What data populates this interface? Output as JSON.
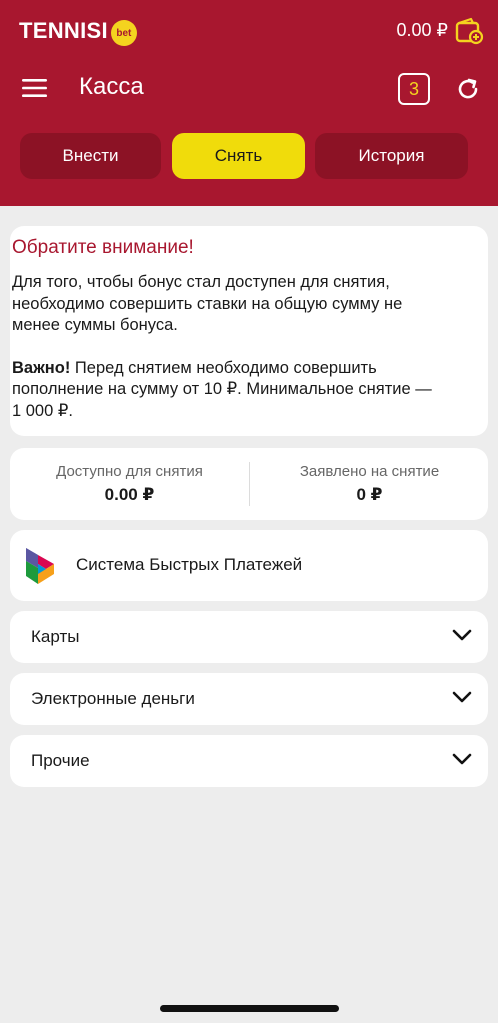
{
  "header": {
    "brand": "TENNISI",
    "brand_badge": "bet",
    "balance": "0.00 ₽",
    "title": "Касса",
    "ticket_count": "3"
  },
  "tabs": [
    {
      "label": "Внести",
      "active": false
    },
    {
      "label": "Снять",
      "active": true
    },
    {
      "label": "История",
      "active": false
    }
  ],
  "notice": {
    "title": "Обратите внимание!",
    "line1": "Для того, чтобы бонус стал доступен для снятия,",
    "line2": "необходимо совершить ставки на общую сумму не",
    "line3": "менее суммы бонуса.",
    "important_label": "Важно!",
    "important_line1": " Перед снятием необходимо совершить",
    "important_line2": "пополнение на сумму от 10 ₽. Минимальное снятие —",
    "important_line3": "1 000 ₽."
  },
  "stats": {
    "available_label": "Доступно для снятия",
    "available_value": "0.00 ₽",
    "requested_label": "Заявлено на снятие",
    "requested_value": "0 ₽"
  },
  "payment_methods": {
    "sbp_label": "Система Быстрых Платежей",
    "sections": [
      {
        "label": "Карты"
      },
      {
        "label": "Электронные деньги"
      },
      {
        "label": "Прочие"
      }
    ]
  },
  "colors": {
    "brand": "#a8172f",
    "accent": "#f0dc0b"
  }
}
